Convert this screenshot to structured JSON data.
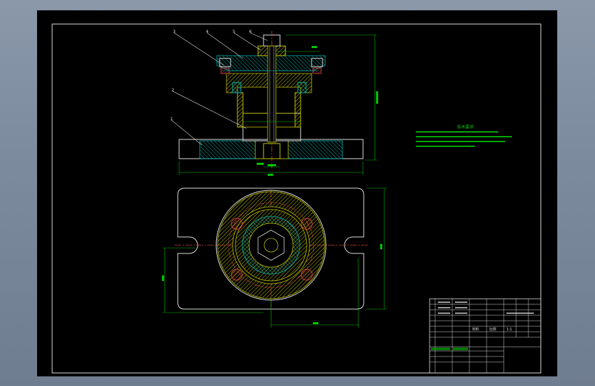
{
  "drawing": {
    "notes_title": "技术要求",
    "balloons": [
      "3",
      "4",
      "5",
      "6",
      "2",
      "1"
    ],
    "title_block": {
      "material_label": "材料",
      "scale_label": "比例",
      "ratio_value": "1:1"
    }
  }
}
